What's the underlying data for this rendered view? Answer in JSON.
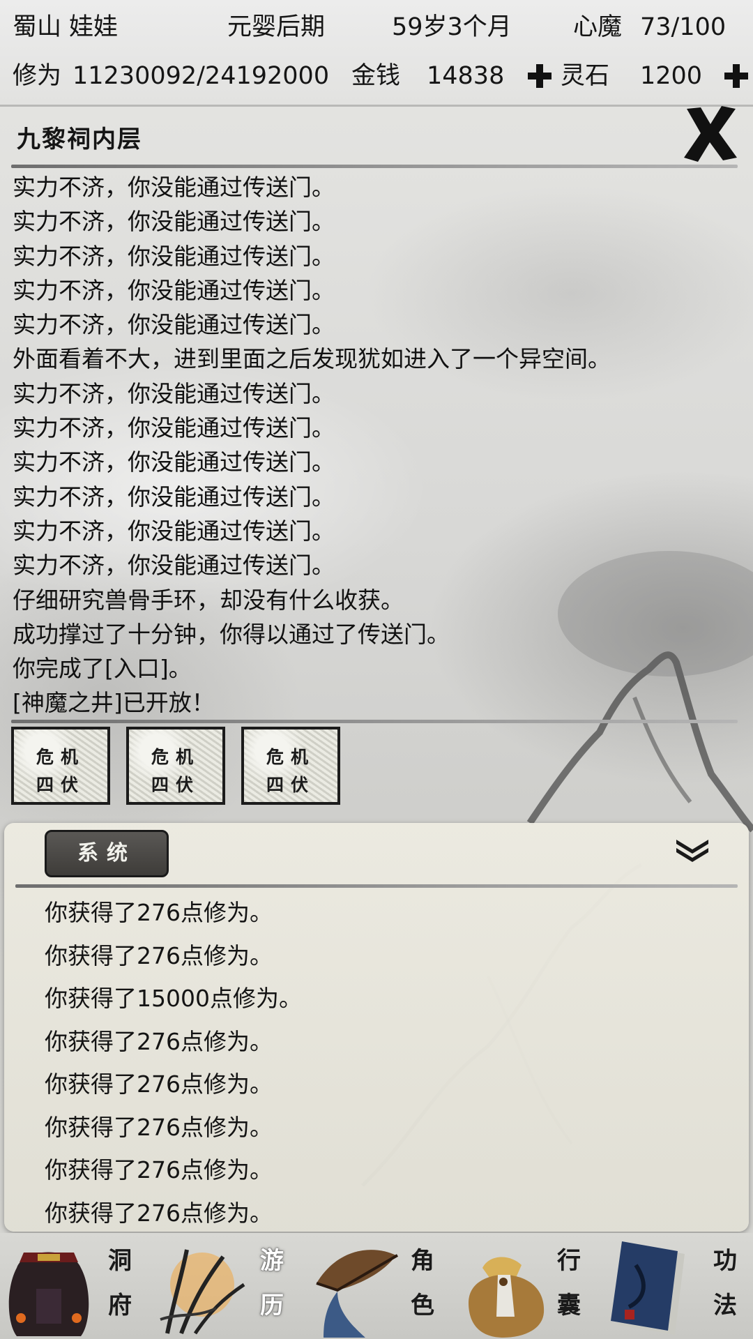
{
  "status": {
    "name": "蜀山 娃娃",
    "realm": "元婴后期",
    "age": "59岁3个月",
    "heart_demon_label": "心魔",
    "heart_demon_value": "73/100",
    "cultivation_label": "修为",
    "cultivation_value": "11230092/24192000",
    "money_label": "金钱",
    "money_value": "14838",
    "spirit_stone_label": "灵石",
    "spirit_stone_value": "1200"
  },
  "location": {
    "title": "九黎祠内层",
    "log": [
      "实力不济，你没能通过传送门。",
      "实力不济，你没能通过传送门。",
      "实力不济，你没能通过传送门。",
      "实力不济，你没能通过传送门。",
      "实力不济，你没能通过传送门。",
      "外面看着不大，进到里面之后发现犹如进入了一个异空间。",
      "实力不济，你没能通过传送门。",
      "实力不济，你没能通过传送门。",
      "实力不济，你没能通过传送门。",
      "实力不济，你没能通过传送门。",
      "实力不济，你没能通过传送门。",
      "实力不济，你没能通过传送门。",
      "仔细研究兽骨手环，却没有什么收获。",
      "成功撑过了十分钟，你得以通过了传送门。",
      "你完成了[入口]。",
      "[神魔之井]已开放！"
    ],
    "events": [
      {
        "line1": "危机",
        "line2": "四伏"
      },
      {
        "line1": "危机",
        "line2": "四伏"
      },
      {
        "line1": "危机",
        "line2": "四伏"
      }
    ]
  },
  "system": {
    "tab_label": "系统",
    "log": [
      "你获得了276点修为。",
      "你获得了276点修为。",
      "你获得了15000点修为。",
      "你获得了276点修为。",
      "你获得了276点修为。",
      "你获得了276点修为。",
      "你获得了276点修为。",
      "你获得了276点修为。"
    ]
  },
  "nav": [
    {
      "label_top": "洞",
      "label_bottom": "府",
      "icon": "cave-mansion-icon"
    },
    {
      "label_top": "游",
      "label_bottom": "历",
      "icon": "travel-icon",
      "active": true
    },
    {
      "label_top": "角",
      "label_bottom": "色",
      "icon": "character-icon"
    },
    {
      "label_top": "行",
      "label_bottom": "囊",
      "icon": "bag-icon"
    },
    {
      "label_top": "功",
      "label_bottom": "法",
      "icon": "skill-book-icon"
    }
  ]
}
